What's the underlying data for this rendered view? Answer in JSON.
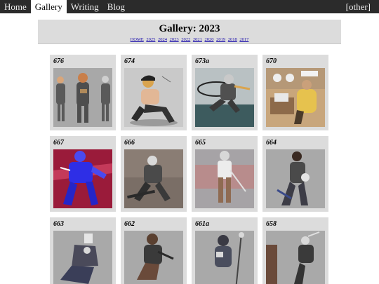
{
  "nav": {
    "items": [
      "Home",
      "Gallery",
      "Writing",
      "Blog"
    ],
    "active": "Gallery",
    "other": "[other]"
  },
  "header": {
    "title": "Gallery: 2023",
    "links": [
      "HOME",
      "2025",
      "2024",
      "2023",
      "2022",
      "2021",
      "2020",
      "2019",
      "2018",
      "2017"
    ]
  },
  "gallery": {
    "cards": [
      {
        "label": "676"
      },
      {
        "label": "674"
      },
      {
        "label": "673a"
      },
      {
        "label": "670"
      },
      {
        "label": "667"
      },
      {
        "label": "666"
      },
      {
        "label": "665"
      },
      {
        "label": "664"
      },
      {
        "label": "663"
      },
      {
        "label": "662"
      },
      {
        "label": "661a"
      },
      {
        "label": "658"
      }
    ]
  }
}
